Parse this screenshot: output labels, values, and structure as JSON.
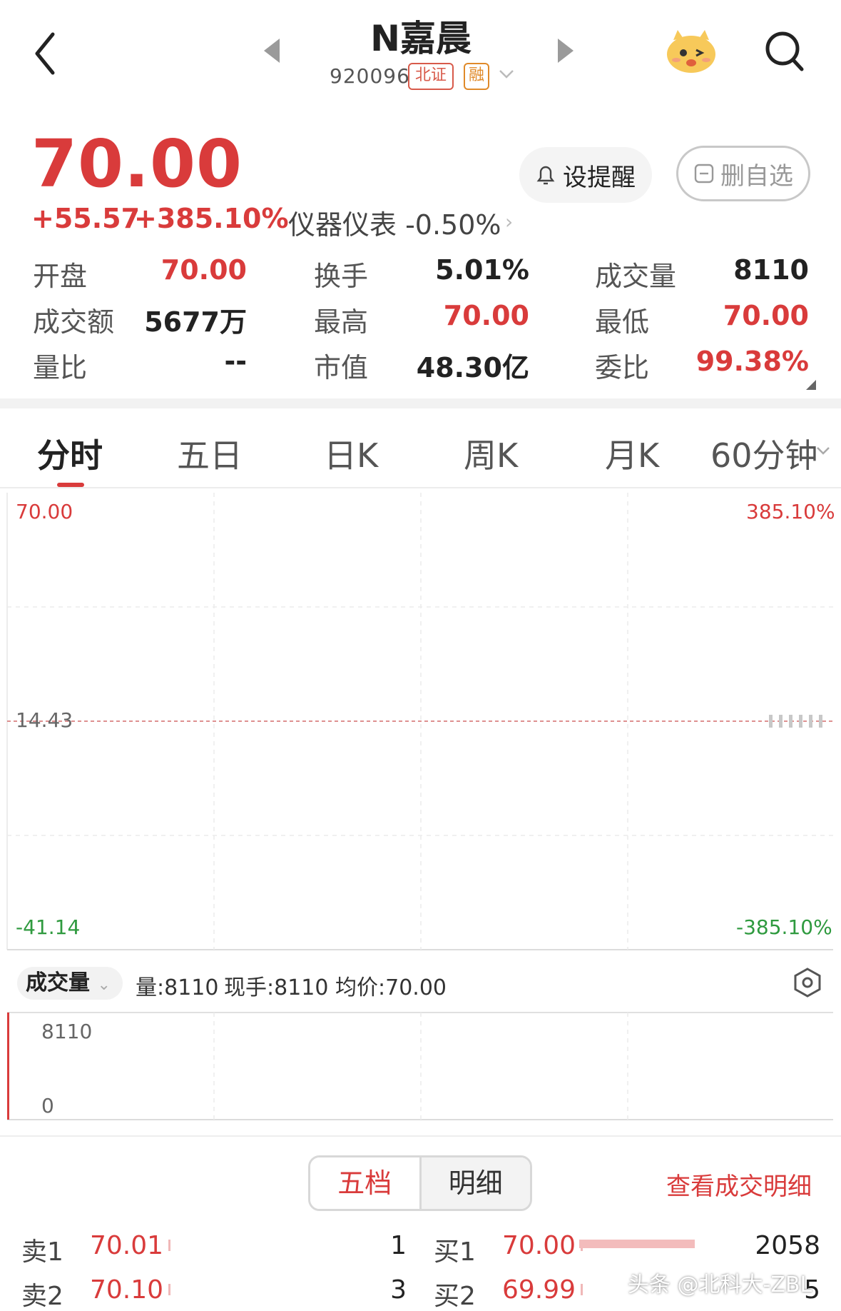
{
  "header": {
    "stock_name": "N嘉晨",
    "stock_code": "920096",
    "tag_exchange": "北证",
    "tag_margin": "融"
  },
  "quote": {
    "price": "70.00",
    "change": "+55.57",
    "change_pct": "+385.10%",
    "sector": "仪器仪表 -0.50%",
    "alert_label": "设提醒",
    "remove_label": "删自选"
  },
  "stats": [
    {
      "label": "开盘",
      "value": "70.00",
      "color": "#d93b3b"
    },
    {
      "label": "换手",
      "value": "5.01%",
      "color": "#222222"
    },
    {
      "label": "成交量",
      "value": "8110",
      "color": "#222222"
    },
    {
      "label": "成交额",
      "value": "5677万",
      "color": "#222222"
    },
    {
      "label": "最高",
      "value": "70.00",
      "color": "#d93b3b"
    },
    {
      "label": "最低",
      "value": "70.00",
      "color": "#d93b3b"
    },
    {
      "label": "量比",
      "value": "--",
      "color": "#222222"
    },
    {
      "label": "市值",
      "value": "48.30亿",
      "color": "#222222"
    },
    {
      "label": "委比",
      "value": "99.38%",
      "color": "#d93b3b"
    }
  ],
  "tabs": [
    "分时",
    "五日",
    "日K",
    "周K",
    "月K",
    "60分钟"
  ],
  "chart": {
    "left_top": "70.00",
    "right_top": "385.10%",
    "mid_label": "14.43",
    "left_bottom": "-41.14",
    "right_bottom": "-385.10%",
    "volume_max_label": "8110",
    "volume_min_label": "0"
  },
  "chart_data": {
    "type": "line",
    "price_axis": [
      -41.14,
      70.0
    ],
    "pct_axis": [
      -385.1,
      385.1
    ],
    "reference_price": 14.43,
    "volume": [
      8110
    ]
  },
  "volume_bar": {
    "selector_label": "成交量",
    "qty": "量:8110",
    "now_hand": "现手:8110",
    "avg_price": "均价:70.00"
  },
  "orderbook": {
    "tab_five": "五档",
    "tab_detail": "明细",
    "view_detail": "查看成交明细",
    "rows": [
      {
        "sell_label": "卖1",
        "sell_price": "70.01",
        "sell_vol": "1",
        "buy_label": "买1",
        "buy_price": "70.00",
        "buy_vol": "2058"
      },
      {
        "sell_label": "卖2",
        "sell_price": "70.10",
        "sell_vol": "3",
        "buy_label": "买2",
        "buy_price": "69.99",
        "buy_vol": "5"
      }
    ]
  },
  "watermark": "头条 @北科大-ZBL",
  "colors": {
    "up": "#d93b3b",
    "down": "#2f9a3f",
    "accent": "#d93b3b"
  }
}
